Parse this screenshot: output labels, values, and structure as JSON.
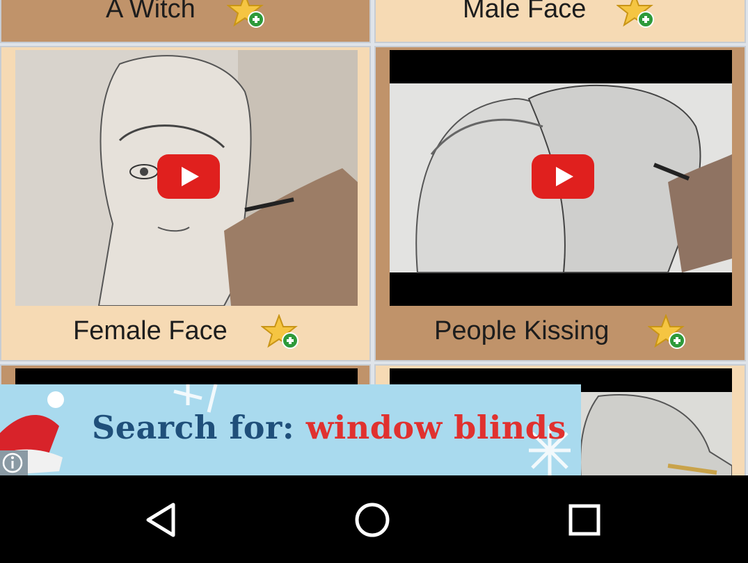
{
  "grid": {
    "items": [
      {
        "title": "A Witch",
        "style": "tan",
        "favorite_icon": "star-add-icon"
      },
      {
        "title": "Male Face",
        "style": "peach",
        "favorite_icon": "star-add-icon"
      },
      {
        "title": "Female Face",
        "style": "peach",
        "favorite_icon": "star-add-icon",
        "video": true
      },
      {
        "title": "People Kissing",
        "style": "tan",
        "favorite_icon": "star-add-icon",
        "video": true
      },
      {
        "title": "",
        "style": "tan"
      },
      {
        "title": "",
        "style": "peach"
      }
    ]
  },
  "ad": {
    "label": "Search for:",
    "query": "window blinds",
    "info_icon": "info-icon",
    "colors": {
      "background": "#a9daee",
      "label": "#1f4f7a",
      "query": "#e0312f"
    }
  },
  "navbar": {
    "back_icon": "back-triangle-icon",
    "home_icon": "home-circle-icon",
    "recents_icon": "recents-square-icon"
  },
  "colors": {
    "card_tan": "#c0936a",
    "card_peach": "#f6dab4",
    "play_red": "#e0201e"
  }
}
